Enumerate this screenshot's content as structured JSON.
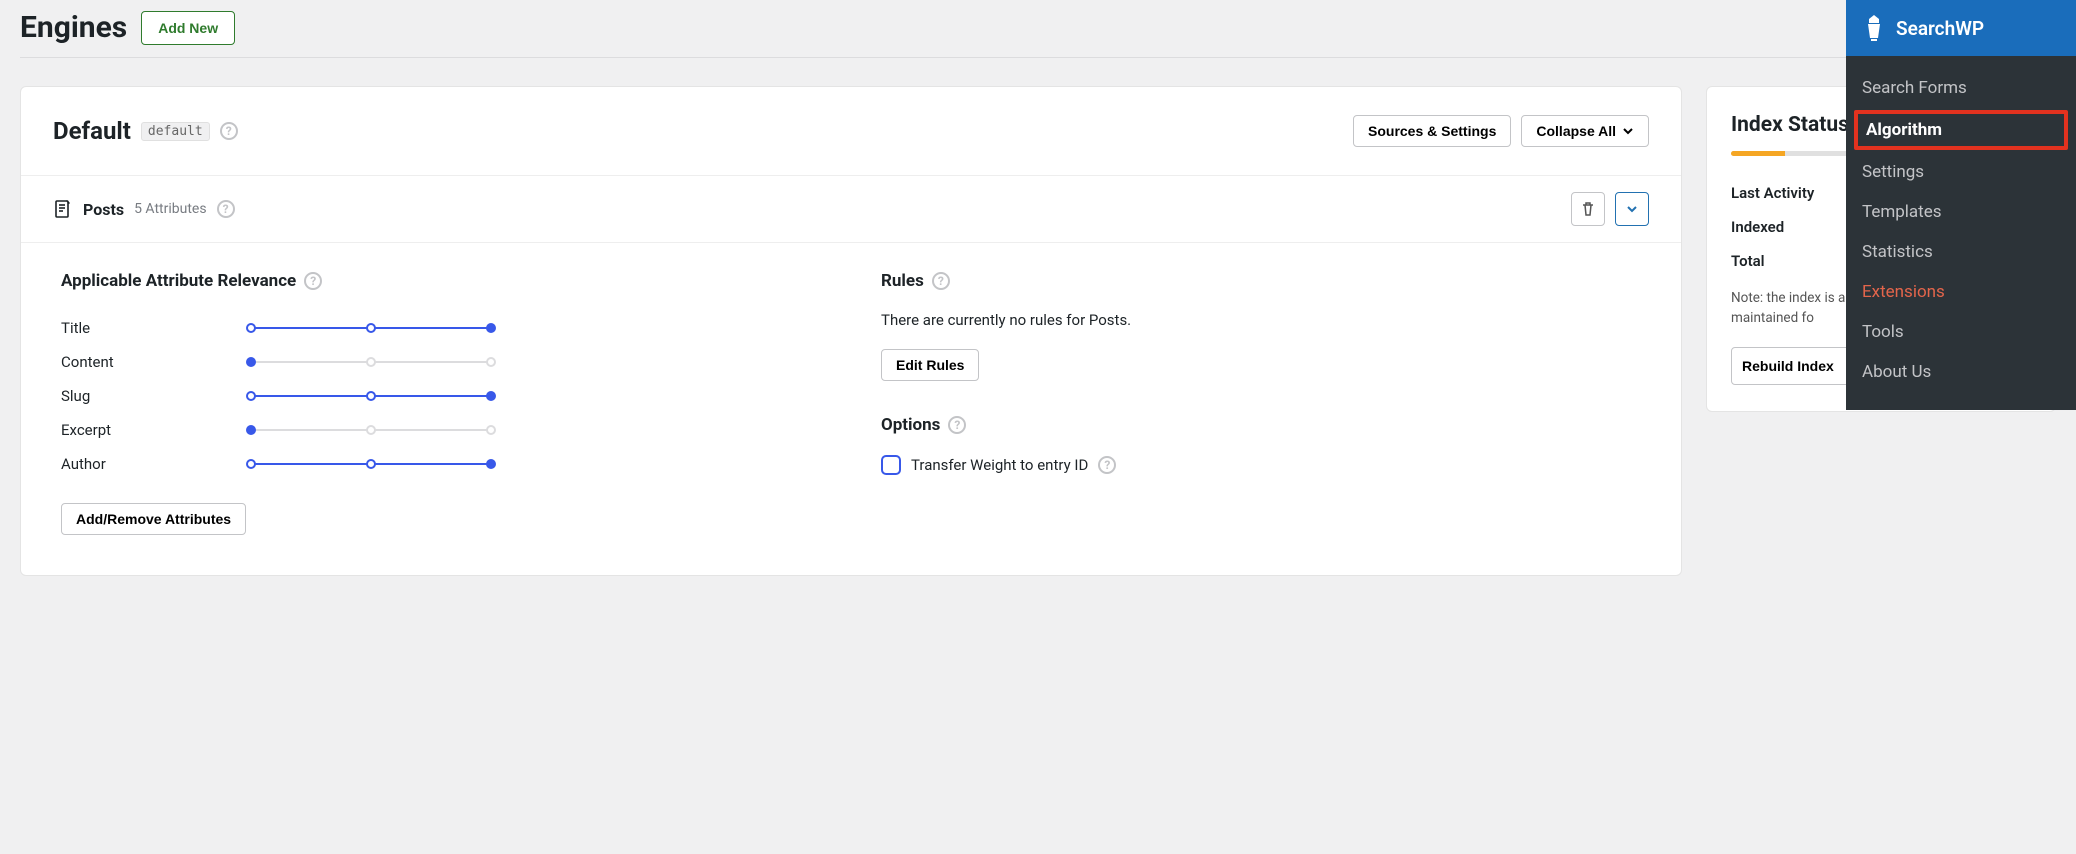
{
  "header": {
    "title": "Engines",
    "add_label": "Add New"
  },
  "engine": {
    "title": "Default",
    "slug": "default",
    "sources_settings_label": "Sources & Settings",
    "collapse_label": "Collapse All"
  },
  "source": {
    "name": "Posts",
    "attr_count": "5 Attributes"
  },
  "relevance": {
    "heading": "Applicable Attribute Relevance",
    "add_remove_label": "Add/Remove Attributes",
    "rows": [
      {
        "label": "Title",
        "value": 2
      },
      {
        "label": "Content",
        "value": 0
      },
      {
        "label": "Slug",
        "value": 2
      },
      {
        "label": "Excerpt",
        "value": 0
      },
      {
        "label": "Author",
        "value": 2
      }
    ]
  },
  "rules": {
    "heading": "Rules",
    "empty": "There are currently no rules for Posts.",
    "edit_label": "Edit Rules"
  },
  "options": {
    "heading": "Options",
    "transfer_label": "Transfer Weight to entry ID"
  },
  "index_status": {
    "heading": "Index Status",
    "last_activity_label": "Last Activity",
    "indexed_label": "Indexed",
    "total_label": "Total",
    "note": "Note: the index is automatically built and maintained fo",
    "rebuild_label": "Rebuild Index"
  },
  "nav": {
    "brand": "SearchWP",
    "items": [
      {
        "label": "Search Forms",
        "active": false
      },
      {
        "label": "Algorithm",
        "active": true,
        "highlight": true
      },
      {
        "label": "Settings",
        "active": false
      },
      {
        "label": "Templates",
        "active": false
      },
      {
        "label": "Statistics",
        "active": false
      },
      {
        "label": "Extensions",
        "active": false,
        "ext": true
      },
      {
        "label": "Tools",
        "active": false
      },
      {
        "label": "About Us",
        "active": false
      }
    ]
  }
}
